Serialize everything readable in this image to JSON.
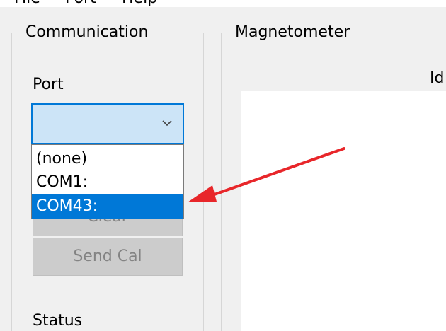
{
  "menubar": {
    "file": "File",
    "port": "Port",
    "help": "Help"
  },
  "communication": {
    "title": "Communication",
    "port_label": "Port",
    "combo_value": "",
    "dropdown_options": [
      "(none)",
      "COM1:",
      "COM43:"
    ],
    "selected_option": "COM43:",
    "clear_button": "Clear",
    "send_cal_button": "Send Cal",
    "status_label": "Status"
  },
  "magnetometer": {
    "title": "Magnetometer",
    "ide_label": "Id"
  },
  "colors": {
    "selection": "#0078d7",
    "combo_background": "#cce4f7",
    "annotation_arrow": "#e8262a",
    "disabled_button": "#cccccc"
  },
  "icons": {
    "combo_arrow": "chevron-down-icon",
    "annotation": "red-arrow-icon"
  }
}
